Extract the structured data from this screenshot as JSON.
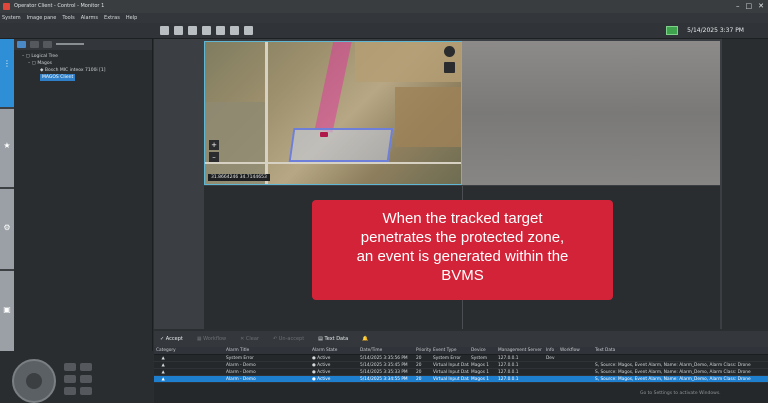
{
  "window": {
    "title": "Operator Client - Control - Monitor 1",
    "controls": [
      "–",
      "□",
      "✕"
    ]
  },
  "menu": [
    "System",
    "Image pane",
    "Tools",
    "Alarms",
    "Extras",
    "Help"
  ],
  "clock": "5/14/2025 3:37 PM",
  "tree": {
    "items": [
      {
        "label": "Logical Tree",
        "depth": 0
      },
      {
        "label": "Magos",
        "depth": 1
      },
      {
        "label": "Bosch MIC inteox 7100i [1]",
        "depth": 2
      },
      {
        "label": "MAGOS Client",
        "depth": 2,
        "selected": true
      }
    ]
  },
  "map": {
    "coords": "31.8664246   34.7144653"
  },
  "callout": {
    "lines": [
      "When the tracked target",
      "penetrates the protected zone,",
      "an event is generated within the",
      "BVMS"
    ]
  },
  "alarm_toolbar": {
    "accept": "Accept",
    "workflow": "Workflow",
    "clear": "Clear",
    "unaccept": "Un-accept",
    "text_data": "Text Data"
  },
  "alarm_table": {
    "columns": [
      "Category",
      "Alarm Title",
      "Alarm State",
      "Date/Time",
      "Priority",
      "Event Type",
      "Device",
      "Management Server",
      "Info",
      "Workflow",
      "Text Data"
    ],
    "rows": [
      [
        "",
        "System Error",
        "Active",
        "5/14/2025 3:35:56 PM",
        "20",
        "System Error",
        "System",
        "127.0.0.1",
        "Dev",
        "",
        ""
      ],
      [
        "",
        "Alarm - Demo",
        "Active",
        "5/14/2025 3:35:45 PM",
        "20",
        "Virtual Input Data",
        "Magos 1",
        "127.0.0.1",
        "",
        "",
        "S, Source: Magos, Event Alarm, Name: Alarm_Demo, Alarm Class: Drone"
      ],
      [
        "",
        "Alarm - Demo",
        "Active",
        "5/14/2025 3:35:33 PM",
        "20",
        "Virtual Input Data",
        "Magos 1",
        "127.0.0.1",
        "",
        "",
        "S, Source: Magos, Event Alarm, Name: Alarm_Demo, Alarm Class: Drone"
      ],
      [
        "",
        "Alarm - Demo",
        "Active",
        "5/14/2025 3:34:55 PM",
        "20",
        "Virtual Input Data",
        "Magos 1",
        "127.0.0.1",
        "",
        "",
        "S, Source: Magos, Event Alarm, Name: Alarm_Demo, Alarm Class: Drone"
      ]
    ],
    "selected_row": 3
  },
  "activate_notice": "Go to Settings to activate Windows.",
  "colors": {
    "accent": "#1e7fcf",
    "callout": "#d32338",
    "zone_border": "#6d7fd8",
    "tile_border": "#5fb7d3"
  }
}
